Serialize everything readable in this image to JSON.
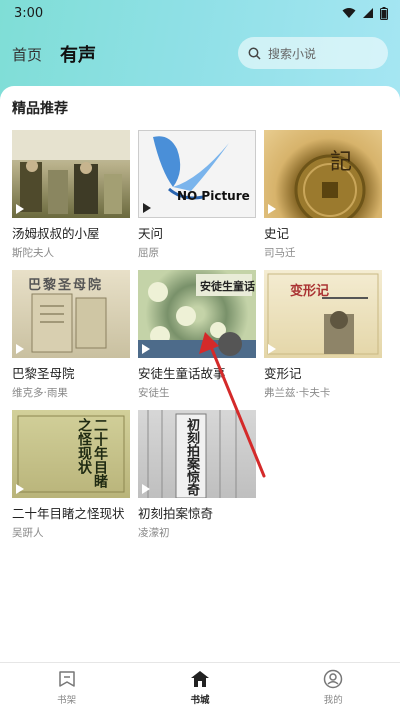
{
  "status": {
    "time": "3:00"
  },
  "nav": {
    "tabs": [
      {
        "label": "首页"
      },
      {
        "label": "有声"
      }
    ]
  },
  "search": {
    "placeholder": "搜索小说"
  },
  "section": {
    "title": "精品推荐"
  },
  "books": [
    {
      "title": "汤姆叔叔的小屋",
      "author": "斯陀夫人",
      "cover_text": ""
    },
    {
      "title": "天问",
      "author": "屈原",
      "cover_text": "NO Picture"
    },
    {
      "title": "史记",
      "author": "司马迁",
      "cover_text": "記"
    },
    {
      "title": "巴黎圣母院",
      "author": "维克多·雨果",
      "cover_text": "巴黎圣母院"
    },
    {
      "title": "安徒生童话故事",
      "author": "安徒生",
      "cover_text": "安徒生童话"
    },
    {
      "title": "变形记",
      "author": "弗兰兹·卡夫卡",
      "cover_text": "变形记"
    },
    {
      "title": "二十年目睹之怪现状",
      "author": "吴趼人",
      "cover_text": "二十年目睹之怪现状"
    },
    {
      "title": "初刻拍案惊奇",
      "author": "凌濛初",
      "cover_text": "初刻拍案惊奇"
    }
  ],
  "bottom_nav": [
    {
      "label": "书架",
      "icon": "bookshelf-icon"
    },
    {
      "label": "书城",
      "icon": "bookstore-icon"
    },
    {
      "label": "我的",
      "icon": "profile-icon"
    }
  ],
  "colors": {
    "header_start": "#7fded6",
    "header_end": "#a6e6f3",
    "annotation_arrow": "#d42a2a"
  }
}
